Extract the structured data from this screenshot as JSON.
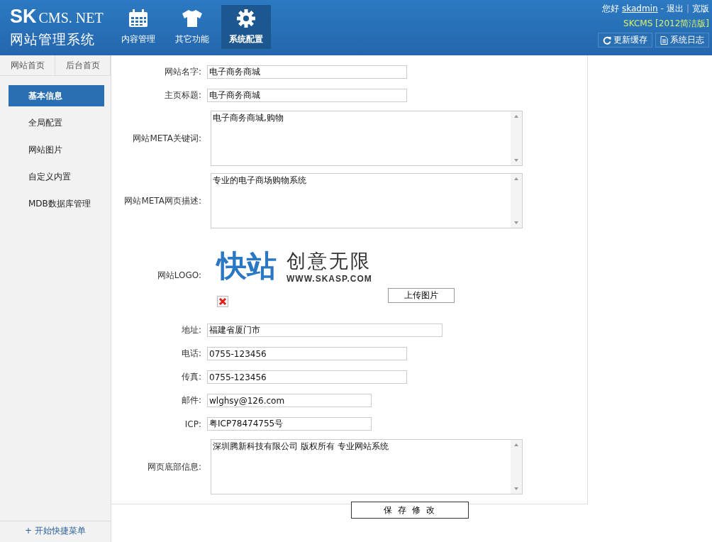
{
  "brand": {
    "title_bold": "SK",
    "title_rest": "CMS. NET",
    "subtitle": "网站管理系统"
  },
  "nav": [
    {
      "label": "内容管理",
      "selected": false
    },
    {
      "label": "其它功能",
      "selected": false
    },
    {
      "label": "系统配置",
      "selected": true
    }
  ],
  "user": {
    "greeting": "您好",
    "name": "skadmin",
    "separator": "-",
    "logout": "退出",
    "divider": "|",
    "wide": "宽版",
    "version": "SKCMS [2012简洁版]"
  },
  "tools": [
    {
      "label": "更新缓存"
    },
    {
      "label": "系统日志"
    }
  ],
  "sidebar": {
    "tabs": [
      "网站首页",
      "后台首页"
    ],
    "items": [
      {
        "label": "基本信息",
        "selected": true
      },
      {
        "label": "全局配置",
        "selected": false
      },
      {
        "label": "网站图片",
        "selected": false
      },
      {
        "label": "自定义内置",
        "selected": false
      },
      {
        "label": "MDB数据库管理",
        "selected": false
      }
    ],
    "footer": "+ 开始快捷菜单"
  },
  "form": [
    {
      "kind": "text",
      "label": "网站名字:",
      "value": "电子商务商城"
    },
    {
      "kind": "text",
      "label": "主页标题:",
      "value": "电子商务商城"
    },
    {
      "kind": "textarea",
      "label": "网站META关键词:",
      "value": "电子商务商城,购物"
    },
    {
      "kind": "textarea",
      "label": "网站META网页描述:",
      "value": "专业的电子商场购物系统"
    },
    {
      "kind": "logo",
      "label": "网站LOGO:",
      "logo_main": "快站",
      "logo_slogan": "创意无限",
      "logo_url": "WWW.SKASP.COM",
      "button": "上传图片"
    },
    {
      "kind": "text",
      "label": "地址:",
      "value": "福建省厦门市"
    },
    {
      "kind": "text",
      "label": "电话:",
      "value": "0755-123456"
    },
    {
      "kind": "text",
      "label": "传真:",
      "value": "0755-123456"
    },
    {
      "kind": "text",
      "label": "邮件:",
      "value": "wlghsy@126.com"
    },
    {
      "kind": "text",
      "label": "ICP:",
      "value": "粤ICP78474755号"
    },
    {
      "kind": "textarea",
      "label": "网页底部信息:",
      "value": "深圳腾新科技有限公司 版权所有 专业网站系统"
    }
  ],
  "save_button": "保 存 修 改"
}
